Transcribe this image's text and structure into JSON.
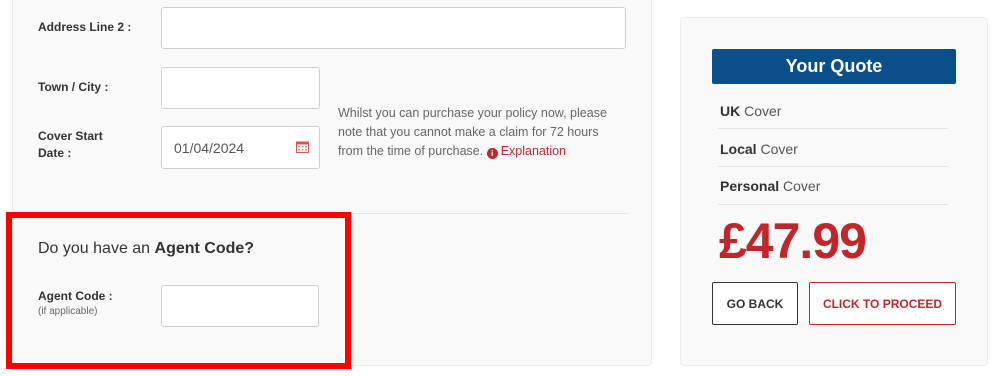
{
  "form": {
    "address_line_2": {
      "label": "Address Line 2 :",
      "value": ""
    },
    "town_city": {
      "label": "Town / City :",
      "value": ""
    },
    "cover_start_date": {
      "label_line1": "Cover Start",
      "label_line2": "Date :",
      "value": "01/04/2024",
      "icon": "calendar-icon"
    },
    "notice": {
      "text": "Whilst you can purchase your policy now, please note that you cannot make a claim for 72 hours from the time of purchase.",
      "info_icon": "i",
      "link_label": "Explanation"
    },
    "agent": {
      "heading_prefix": "Do you have an ",
      "heading_bold": "Agent Code?",
      "label": "Agent Code :",
      "sub_label": "(if applicable)",
      "value": ""
    }
  },
  "quote": {
    "title": "Your Quote",
    "covers": [
      {
        "bold": "UK",
        "rest": " Cover"
      },
      {
        "bold": "Local",
        "rest": " Cover"
      },
      {
        "bold": "Personal",
        "rest": " Cover"
      }
    ],
    "price": "£47.99",
    "back_label": "GO BACK",
    "proceed_label": "CLICK TO PROCEED"
  },
  "colors": {
    "brand_blue": "#0b4f8a",
    "accent_red": "#c0272d",
    "highlight_red": "#ff0000"
  }
}
